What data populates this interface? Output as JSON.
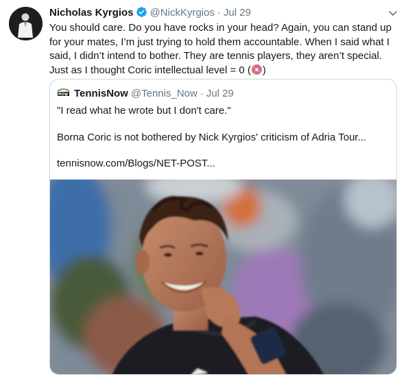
{
  "tweet": {
    "author_name": "Nicholas Kyrgios",
    "author_handle": "@NickKyrgios",
    "separator": "·",
    "date": "Jul 29",
    "text_line1": "You should care. Do you have rocks in your head? Again, you can stand up",
    "text_line2": "for your mates, I’m just trying to hold them accountable. When I said what I",
    "text_line3": "said, I didn’t intend to bother. They are tennis players, they aren’t special.",
    "text_line4_before": "Just as I thought Coric intellectual level = 0 (",
    "text_line4_after": ")",
    "emoji": "doughnut-emoji"
  },
  "quote": {
    "author_name": "TennisNow",
    "author_handle": "@Tennis_Now",
    "separator": "·",
    "date": "Jul 29",
    "line1": "\"I read what he wrote but I don't care.\"",
    "line2": "Borna Coric is not bothered by Nick Kyrgios' criticism of Adria Tour...",
    "line3": "tennisnow.com/Blogs/NET-POST..."
  },
  "icons": {
    "verified": "verified-badge-icon",
    "caret": "chevron-down-icon"
  },
  "colors": {
    "verified_blue": "#1da1f2",
    "secondary_text": "#657786",
    "border": "#ccd6dd",
    "tennisnow_green": "#6aa84f"
  }
}
